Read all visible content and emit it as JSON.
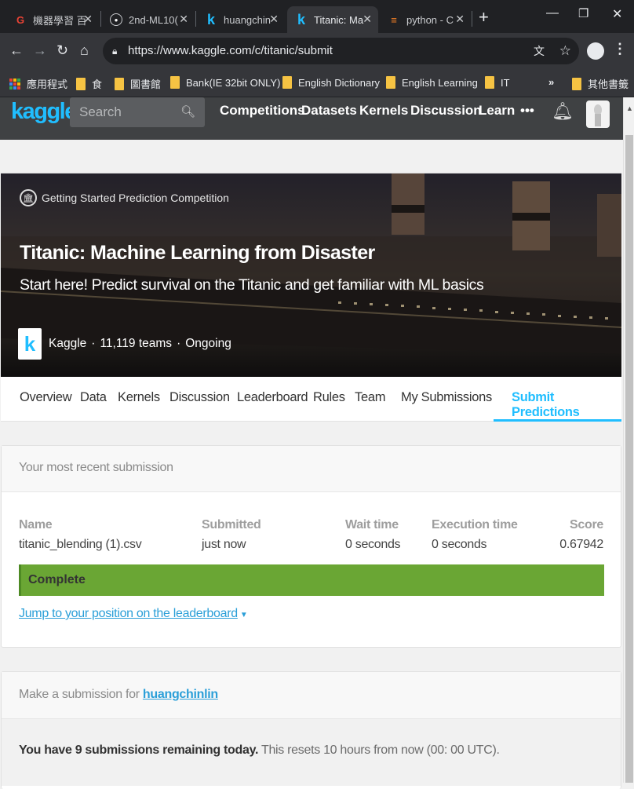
{
  "browser": {
    "tabs": [
      {
        "label": "機器學習 百",
        "icon": "G"
      },
      {
        "label": "2nd-ML10(",
        "icon": "gh"
      },
      {
        "label": "huangchin",
        "icon": "k"
      },
      {
        "label": "Titanic: Ma",
        "icon": "k",
        "active": true
      },
      {
        "label": "python - C",
        "icon": "so"
      }
    ],
    "url": "https://www.kaggle.com/c/titanic/submit",
    "bookmarks": [
      "應用程式",
      "食",
      "圖書館",
      "Bank(IE 32bit ONLY)",
      "English Dictionary",
      "English Learning",
      "IT",
      "»",
      "其他書籤"
    ]
  },
  "kaggle": {
    "logo": "kaggle",
    "search_placeholder": "Search",
    "nav": [
      "Competitions",
      "Datasets",
      "Kernels",
      "Discussion",
      "Learn",
      "•••"
    ]
  },
  "hero": {
    "badge": "Getting Started Prediction Competition",
    "title": "Titanic: Machine Learning from Disaster",
    "subtitle": "Start here! Predict survival on the Titanic and get familiar with ML basics",
    "host": "Kaggle",
    "teams": "11,119 teams",
    "status": "Ongoing",
    "sep": "·"
  },
  "tabs": [
    "Overview",
    "Data",
    "Kernels",
    "Discussion",
    "Leaderboard",
    "Rules",
    "Team",
    "My Submissions",
    "Submit Predictions"
  ],
  "recent": {
    "heading": "Your most recent submission",
    "headers": {
      "name": "Name",
      "submitted": "Submitted",
      "wait": "Wait time",
      "exec": "Execution time",
      "score": "Score"
    },
    "row": {
      "name": "titanic_blending (1).csv",
      "submitted": "just now",
      "wait": "0 seconds",
      "exec": "0 seconds",
      "score": "0.67942"
    },
    "status": "Complete",
    "jump": "Jump to your position on the leaderboard"
  },
  "make": {
    "prefix": "Make a submission for",
    "user": "huangchinlin",
    "remaining_bold": "You have 9 submissions remaining today.",
    "remaining_rest": "This resets 10 hours from now (00: 00 UTC)."
  }
}
